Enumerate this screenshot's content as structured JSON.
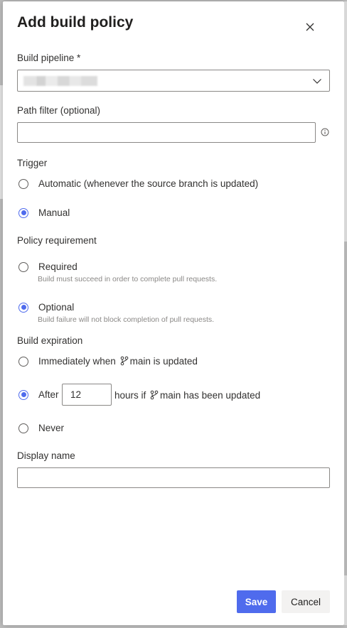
{
  "dialog": {
    "title": "Add build policy"
  },
  "build_pipeline": {
    "label": "Build pipeline *"
  },
  "path_filter": {
    "label": "Path filter (optional)",
    "value": ""
  },
  "trigger": {
    "label": "Trigger",
    "options": [
      {
        "label": "Automatic (whenever the source branch is updated)",
        "selected": false
      },
      {
        "label": "Manual",
        "selected": true
      }
    ]
  },
  "policy_requirement": {
    "label": "Policy requirement",
    "options": [
      {
        "label": "Required",
        "description": "Build must succeed in order to complete pull requests.",
        "selected": false
      },
      {
        "label": "Optional",
        "description": "Build failure will not block completion of pull requests.",
        "selected": true
      }
    ]
  },
  "build_expiration": {
    "label": "Build expiration",
    "immediately": {
      "prefix": "Immediately when",
      "branch": "main",
      "suffix": "is updated",
      "selected": false
    },
    "after": {
      "prefix": "After",
      "hours": "12",
      "middle": "hours if",
      "branch": "main",
      "suffix": "has been updated",
      "selected": true
    },
    "never": {
      "label": "Never",
      "selected": false
    }
  },
  "display_name": {
    "label": "Display name",
    "value": ""
  },
  "footer": {
    "save_label": "Save",
    "cancel_label": "Cancel"
  },
  "colors": {
    "accent": "#4f6bed",
    "border": "#8a8886",
    "text": "#323130",
    "muted": "#8a8886"
  },
  "icons": {
    "close": "close-icon",
    "dropdown": "chevron-down-icon",
    "info": "info-icon",
    "branch": "branch-icon"
  }
}
